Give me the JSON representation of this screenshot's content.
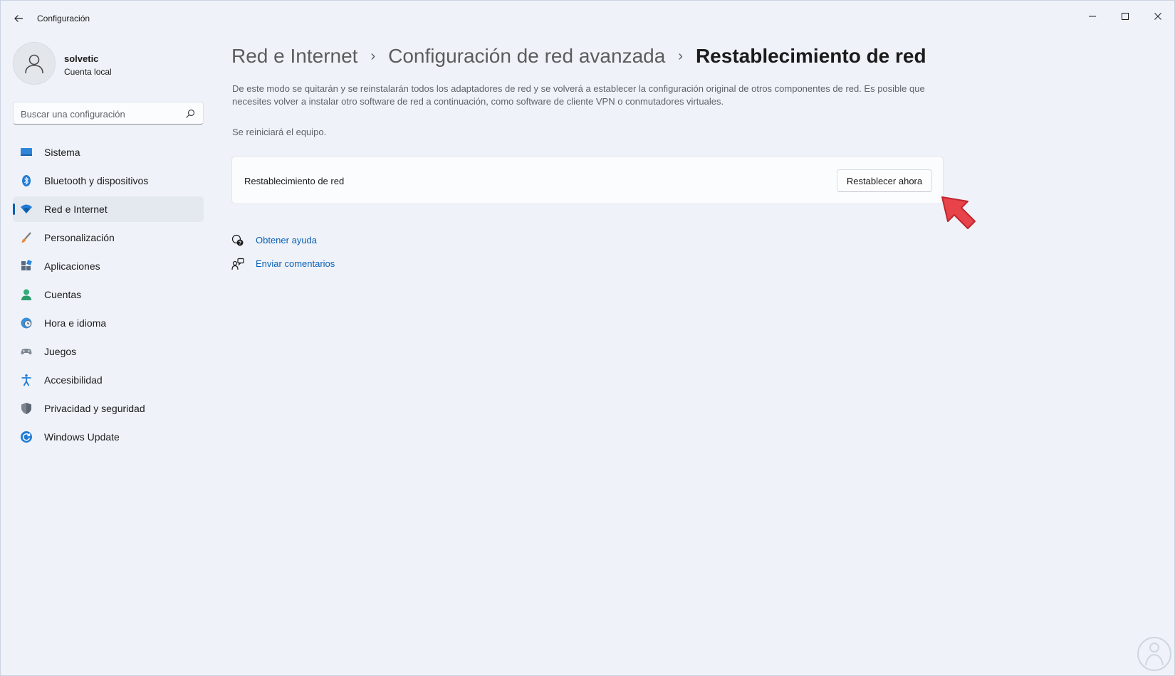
{
  "window": {
    "title": "Configuración",
    "controls": [
      "minimize-icon",
      "maximize-icon",
      "close-icon"
    ]
  },
  "profile": {
    "name": "solvetic",
    "subtitle": "Cuenta local"
  },
  "search": {
    "placeholder": "Buscar una configuración",
    "value": ""
  },
  "sidebar": {
    "items": [
      {
        "label": "Sistema",
        "icon": "system-display-icon",
        "active": false
      },
      {
        "label": "Bluetooth y dispositivos",
        "icon": "bluetooth-icon",
        "active": false
      },
      {
        "label": "Red e Internet",
        "icon": "wifi-icon",
        "active": true
      },
      {
        "label": "Personalización",
        "icon": "paintbrush-icon",
        "active": false
      },
      {
        "label": "Aplicaciones",
        "icon": "apps-icon",
        "active": false
      },
      {
        "label": "Cuentas",
        "icon": "person-icon",
        "active": false
      },
      {
        "label": "Hora e idioma",
        "icon": "globe-clock-icon",
        "active": false
      },
      {
        "label": "Juegos",
        "icon": "gamepad-icon",
        "active": false
      },
      {
        "label": "Accesibilidad",
        "icon": "accessibility-icon",
        "active": false
      },
      {
        "label": "Privacidad y seguridad",
        "icon": "shield-icon",
        "active": false
      },
      {
        "label": "Windows Update",
        "icon": "update-icon",
        "active": false
      }
    ]
  },
  "breadcrumb": {
    "items": [
      "Red e Internet",
      "Configuración de red avanzada",
      "Restablecimiento de red"
    ]
  },
  "main": {
    "description": "De este modo se quitarán y se reinstalarán todos los adaptadores de red y se volverá a establecer la configuración original de otros componentes de red. Es posible que necesites volver a instalar otro software de red a continuación, como software de cliente VPN o conmutadores virtuales.",
    "restart_note": "Se reiniciará el equipo.",
    "card": {
      "label": "Restablecimiento de red",
      "button": "Restablecer ahora"
    },
    "links": [
      {
        "label": "Obtener ayuda",
        "icon": "help-icon"
      },
      {
        "label": "Enviar comentarios",
        "icon": "feedback-icon"
      }
    ]
  },
  "colors": {
    "accent": "#0a5fb4",
    "background": "#eff3f9",
    "annotation_arrow": "#e8434a"
  }
}
